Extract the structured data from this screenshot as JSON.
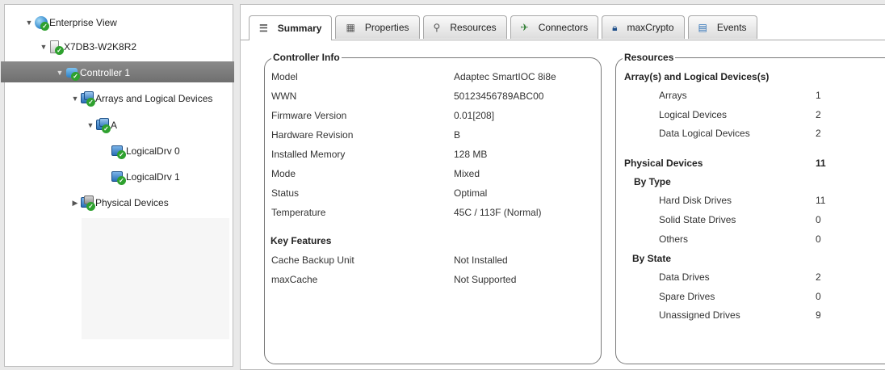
{
  "tree": {
    "enterprise": "Enterprise View",
    "host": "X7DB3-W2K8R2",
    "controller": "Controller 1",
    "arrays": "Arrays and Logical Devices",
    "array_a": "A",
    "ld0": "LogicalDrv 0",
    "ld1": "LogicalDrv 1",
    "physical": "Physical Devices"
  },
  "tabs": [
    {
      "label": "Summary",
      "icon": "document-icon"
    },
    {
      "label": "Properties",
      "icon": "properties-icon"
    },
    {
      "label": "Resources",
      "icon": "magnifier-icon"
    },
    {
      "label": "Connectors",
      "icon": "connector-icon"
    },
    {
      "label": "maxCrypto",
      "icon": "lock-icon"
    },
    {
      "label": "Events",
      "icon": "calendar-icon"
    }
  ],
  "controller_info": {
    "title": "Controller Info",
    "rows": [
      {
        "label": "Model",
        "value": "Adaptec SmartIOC 8i8e"
      },
      {
        "label": "WWN",
        "value": "50123456789ABC00"
      },
      {
        "label": "Firmware Version",
        "value": "0.01[208]"
      },
      {
        "label": "Hardware Revision",
        "value": "B"
      },
      {
        "label": "Installed Memory",
        "value": "128 MB"
      },
      {
        "label": "Mode",
        "value": "Mixed"
      },
      {
        "label": "Status",
        "value": "Optimal"
      },
      {
        "label": "Temperature",
        "value": "45C / 113F (Normal)"
      }
    ],
    "features_title": "Key Features",
    "features": [
      {
        "label": "Cache Backup Unit",
        "value": "Not Installed"
      },
      {
        "label": "maxCache",
        "value": "Not Supported"
      }
    ]
  },
  "resources": {
    "title": "Resources",
    "arrays_heading": "Array(s) and Logical Devices(s)",
    "arrays_rows": [
      {
        "label": "Arrays",
        "value": "1"
      },
      {
        "label": "Logical Devices",
        "value": "2"
      },
      {
        "label": "Data Logical Devices",
        "value": "2"
      }
    ],
    "physical_heading": "Physical Devices",
    "physical_total": "11",
    "by_type": "By Type",
    "type_rows": [
      {
        "label": "Hard Disk Drives",
        "value": "11"
      },
      {
        "label": "Solid State Drives",
        "value": "0"
      },
      {
        "label": "Others",
        "value": "0"
      }
    ],
    "by_state": "By State",
    "state_rows": [
      {
        "label": "Data Drives",
        "value": "2"
      },
      {
        "label": "Spare Drives",
        "value": "0"
      },
      {
        "label": "Unassigned Drives",
        "value": "9"
      }
    ]
  }
}
